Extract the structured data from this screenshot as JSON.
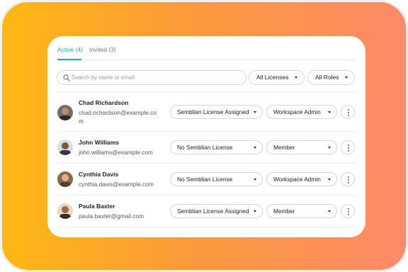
{
  "tabs": {
    "active": "Active (4)",
    "invited": "Invited (3)"
  },
  "search": {
    "placeholder": "Search by name or email",
    "value": ""
  },
  "filters": {
    "licenses": "All Licenses",
    "roles": "All Roles"
  },
  "users": [
    {
      "name": "Chad Richardson",
      "email": "chad.richardson@example.com",
      "license": "Semblian License Assigned",
      "role": "Workspace Admin"
    },
    {
      "name": "John Williams",
      "email": "john.williams@example.com",
      "license": "No Semblian License",
      "role": "Member"
    },
    {
      "name": "Cynthia Davis",
      "email": "cynthia.davis@example.com",
      "license": "No Semblian License",
      "role": "Workspace Admin"
    },
    {
      "name": "Paula Baxter",
      "email": "paula.baxter@gmail.com",
      "license": "Semblian License Assigned",
      "role": "Member"
    }
  ],
  "colors": {
    "accent": "#1ca9c9",
    "gradient_start": "#fdb813",
    "gradient_end": "#fd8a6a"
  },
  "icons": {
    "search": "search-icon",
    "caret": "chevron-down-icon",
    "more": "more-vertical-icon"
  }
}
